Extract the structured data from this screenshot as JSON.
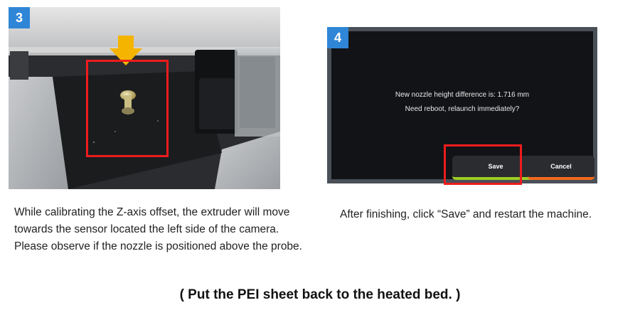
{
  "step3": {
    "badge": "3",
    "description": "While calibrating the Z-axis offset, the extruder will move towards the sensor located the left side of the camera. Please observe if the nozzle is positioned above the probe."
  },
  "step4": {
    "badge": "4",
    "message_line1": "New nozzle height difference is: 1.716 mm",
    "message_line2": "Need reboot, relaunch immediately?",
    "save_label": "Save",
    "cancel_label": "Cancel",
    "description": "After finishing, click “Save” and restart the machine."
  },
  "note": "( Put the PEI sheet back to the heated bed. )",
  "colors": {
    "badge": "#2f86d6",
    "highlight_box": "#ee1c1c",
    "arrow": "#f5b400",
    "save_underline": "#9ccf22",
    "cancel_underline": "#f46a1c"
  },
  "icons": {
    "pointer": "down-arrow-icon"
  }
}
